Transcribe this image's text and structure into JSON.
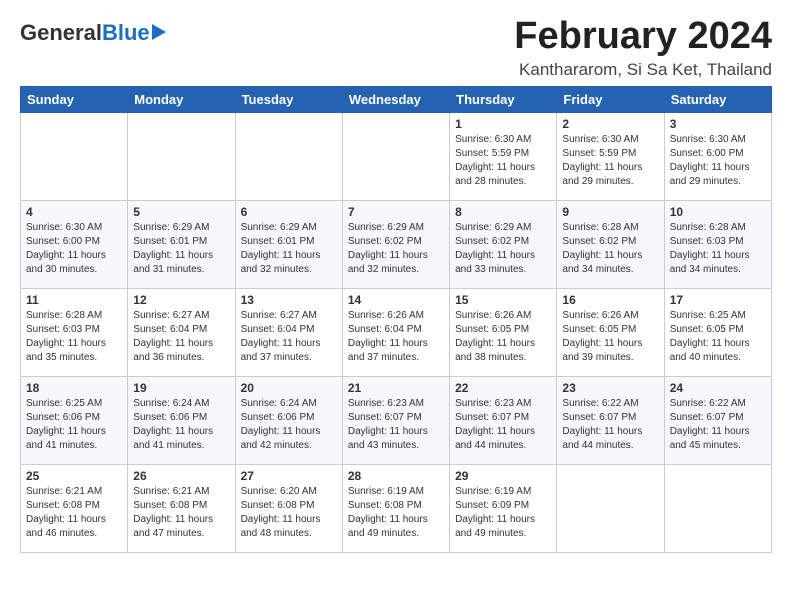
{
  "header": {
    "logo_general": "General",
    "logo_blue": "Blue",
    "month_title": "February 2024",
    "location": "Kanthararom, Si Sa Ket, Thailand"
  },
  "days_of_week": [
    "Sunday",
    "Monday",
    "Tuesday",
    "Wednesday",
    "Thursday",
    "Friday",
    "Saturday"
  ],
  "weeks": [
    [
      {
        "day": "",
        "info": ""
      },
      {
        "day": "",
        "info": ""
      },
      {
        "day": "",
        "info": ""
      },
      {
        "day": "",
        "info": ""
      },
      {
        "day": "1",
        "info": "Sunrise: 6:30 AM\nSunset: 5:59 PM\nDaylight: 11 hours\nand 28 minutes."
      },
      {
        "day": "2",
        "info": "Sunrise: 6:30 AM\nSunset: 5:59 PM\nDaylight: 11 hours\nand 29 minutes."
      },
      {
        "day": "3",
        "info": "Sunrise: 6:30 AM\nSunset: 6:00 PM\nDaylight: 11 hours\nand 29 minutes."
      }
    ],
    [
      {
        "day": "4",
        "info": "Sunrise: 6:30 AM\nSunset: 6:00 PM\nDaylight: 11 hours\nand 30 minutes."
      },
      {
        "day": "5",
        "info": "Sunrise: 6:29 AM\nSunset: 6:01 PM\nDaylight: 11 hours\nand 31 minutes."
      },
      {
        "day": "6",
        "info": "Sunrise: 6:29 AM\nSunset: 6:01 PM\nDaylight: 11 hours\nand 32 minutes."
      },
      {
        "day": "7",
        "info": "Sunrise: 6:29 AM\nSunset: 6:02 PM\nDaylight: 11 hours\nand 32 minutes."
      },
      {
        "day": "8",
        "info": "Sunrise: 6:29 AM\nSunset: 6:02 PM\nDaylight: 11 hours\nand 33 minutes."
      },
      {
        "day": "9",
        "info": "Sunrise: 6:28 AM\nSunset: 6:02 PM\nDaylight: 11 hours\nand 34 minutes."
      },
      {
        "day": "10",
        "info": "Sunrise: 6:28 AM\nSunset: 6:03 PM\nDaylight: 11 hours\nand 34 minutes."
      }
    ],
    [
      {
        "day": "11",
        "info": "Sunrise: 6:28 AM\nSunset: 6:03 PM\nDaylight: 11 hours\nand 35 minutes."
      },
      {
        "day": "12",
        "info": "Sunrise: 6:27 AM\nSunset: 6:04 PM\nDaylight: 11 hours\nand 36 minutes."
      },
      {
        "day": "13",
        "info": "Sunrise: 6:27 AM\nSunset: 6:04 PM\nDaylight: 11 hours\nand 37 minutes."
      },
      {
        "day": "14",
        "info": "Sunrise: 6:26 AM\nSunset: 6:04 PM\nDaylight: 11 hours\nand 37 minutes."
      },
      {
        "day": "15",
        "info": "Sunrise: 6:26 AM\nSunset: 6:05 PM\nDaylight: 11 hours\nand 38 minutes."
      },
      {
        "day": "16",
        "info": "Sunrise: 6:26 AM\nSunset: 6:05 PM\nDaylight: 11 hours\nand 39 minutes."
      },
      {
        "day": "17",
        "info": "Sunrise: 6:25 AM\nSunset: 6:05 PM\nDaylight: 11 hours\nand 40 minutes."
      }
    ],
    [
      {
        "day": "18",
        "info": "Sunrise: 6:25 AM\nSunset: 6:06 PM\nDaylight: 11 hours\nand 41 minutes."
      },
      {
        "day": "19",
        "info": "Sunrise: 6:24 AM\nSunset: 6:06 PM\nDaylight: 11 hours\nand 41 minutes."
      },
      {
        "day": "20",
        "info": "Sunrise: 6:24 AM\nSunset: 6:06 PM\nDaylight: 11 hours\nand 42 minutes."
      },
      {
        "day": "21",
        "info": "Sunrise: 6:23 AM\nSunset: 6:07 PM\nDaylight: 11 hours\nand 43 minutes."
      },
      {
        "day": "22",
        "info": "Sunrise: 6:23 AM\nSunset: 6:07 PM\nDaylight: 11 hours\nand 44 minutes."
      },
      {
        "day": "23",
        "info": "Sunrise: 6:22 AM\nSunset: 6:07 PM\nDaylight: 11 hours\nand 44 minutes."
      },
      {
        "day": "24",
        "info": "Sunrise: 6:22 AM\nSunset: 6:07 PM\nDaylight: 11 hours\nand 45 minutes."
      }
    ],
    [
      {
        "day": "25",
        "info": "Sunrise: 6:21 AM\nSunset: 6:08 PM\nDaylight: 11 hours\nand 46 minutes."
      },
      {
        "day": "26",
        "info": "Sunrise: 6:21 AM\nSunset: 6:08 PM\nDaylight: 11 hours\nand 47 minutes."
      },
      {
        "day": "27",
        "info": "Sunrise: 6:20 AM\nSunset: 6:08 PM\nDaylight: 11 hours\nand 48 minutes."
      },
      {
        "day": "28",
        "info": "Sunrise: 6:19 AM\nSunset: 6:08 PM\nDaylight: 11 hours\nand 49 minutes."
      },
      {
        "day": "29",
        "info": "Sunrise: 6:19 AM\nSunset: 6:09 PM\nDaylight: 11 hours\nand 49 minutes."
      },
      {
        "day": "",
        "info": ""
      },
      {
        "day": "",
        "info": ""
      }
    ]
  ]
}
